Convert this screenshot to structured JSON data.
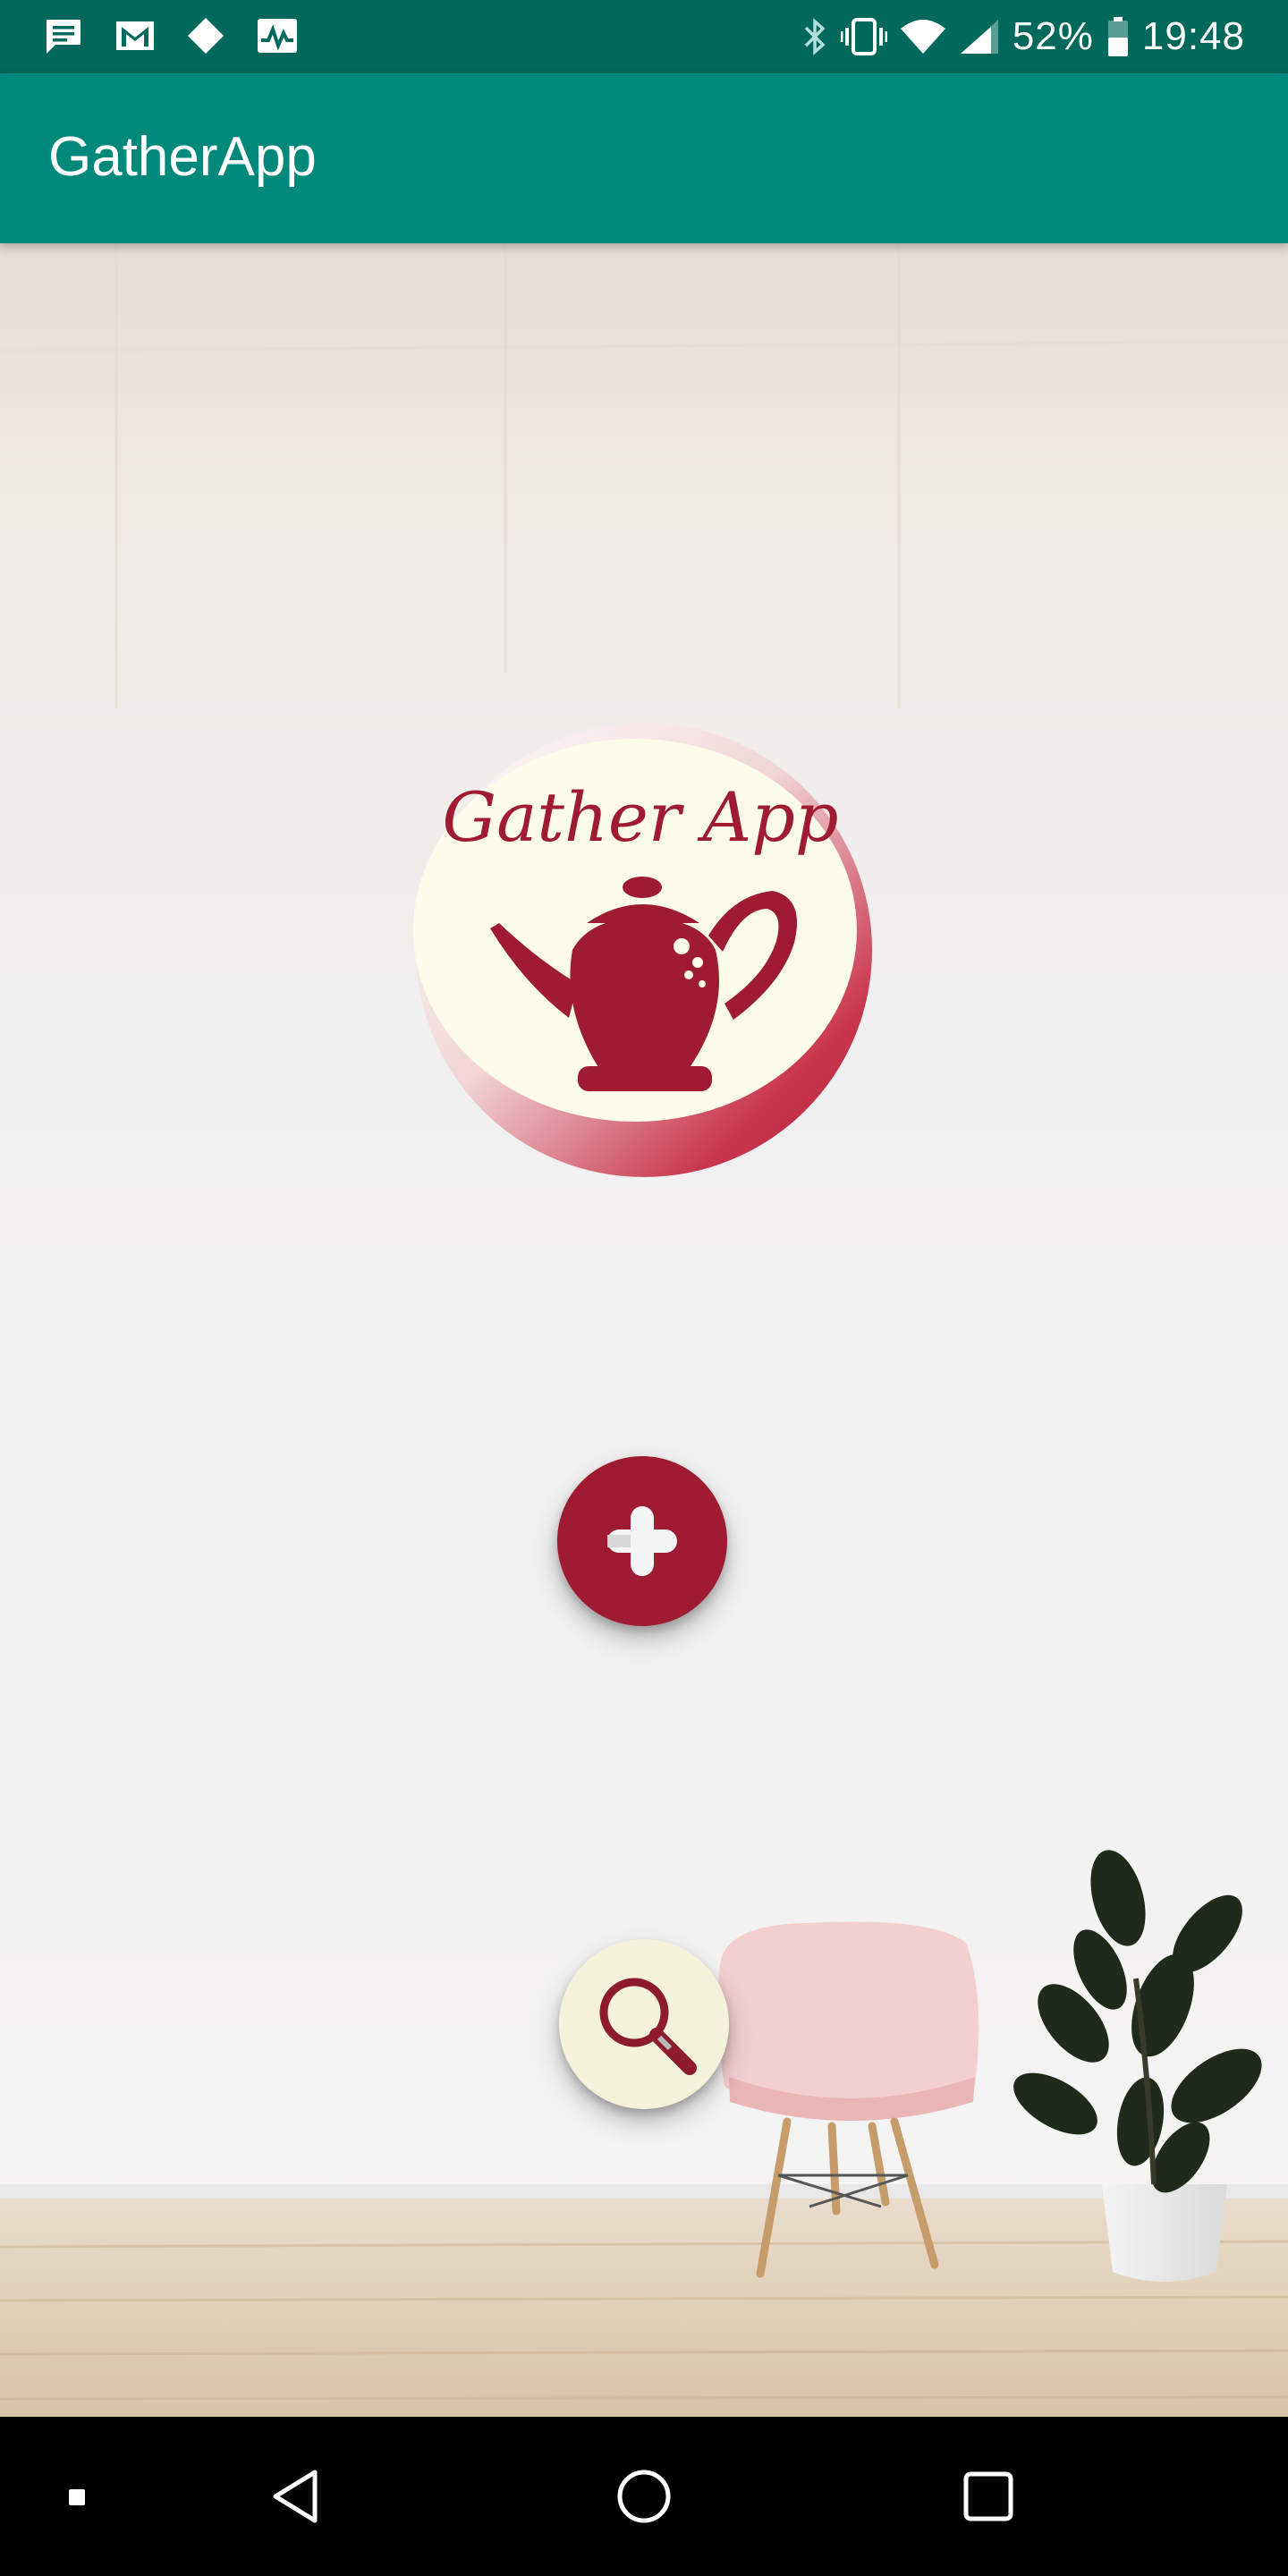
{
  "status_bar": {
    "battery_percent": "52%",
    "time": "19:48",
    "left_icons": [
      "message-icon",
      "gmail-icon",
      "diamond-icon",
      "activity-icon"
    ],
    "right_icons": [
      "bluetooth-icon",
      "vibrate-icon",
      "wifi-icon",
      "signal-icon",
      "battery-icon"
    ]
  },
  "app_bar": {
    "title": "GatherApp"
  },
  "logo": {
    "text": "Gather App",
    "icon": "teapot-icon"
  },
  "actions": {
    "add_icon": "plus-icon",
    "search_icon": "magnifier-icon"
  },
  "nav_bar": {
    "items": [
      "square-icon",
      "back-icon",
      "home-icon",
      "recents-icon"
    ]
  },
  "colors": {
    "status_bar": "#00695c",
    "app_bar": "#00897b",
    "brand_red": "#9e1b32",
    "cream": "#fdfbea"
  }
}
